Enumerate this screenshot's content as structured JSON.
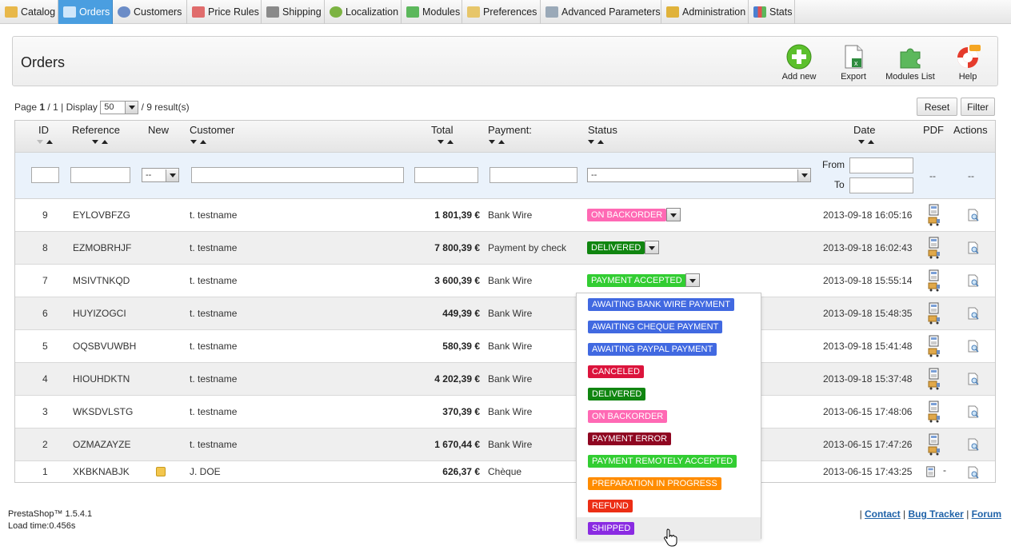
{
  "menu": {
    "tabs": [
      {
        "label": "Catalog",
        "icon": "folder-icon"
      },
      {
        "label": "Orders",
        "icon": "cart-icon"
      },
      {
        "label": "Customers",
        "icon": "user-icon"
      },
      {
        "label": "Price Rules",
        "icon": "price-tag-icon"
      },
      {
        "label": "Shipping",
        "icon": "truck-icon"
      },
      {
        "label": "Localization",
        "icon": "globe-icon"
      },
      {
        "label": "Modules",
        "icon": "puzzle-icon"
      },
      {
        "label": "Preferences",
        "icon": "preferences-icon"
      },
      {
        "label": "Advanced Parameters",
        "icon": "wrench-icon"
      },
      {
        "label": "Administration",
        "icon": "key-icon"
      },
      {
        "label": "Stats",
        "icon": "chart-icon"
      }
    ]
  },
  "toolbar": {
    "title": "Orders",
    "buttons": [
      {
        "label": "Add new",
        "icon": "add-icon"
      },
      {
        "label": "Export",
        "icon": "export-icon"
      },
      {
        "label": "Modules List",
        "icon": "modules-icon"
      },
      {
        "label": "Help",
        "icon": "help-icon"
      }
    ]
  },
  "pager": {
    "page_label": "Page",
    "page": "1",
    "sep": "/",
    "pages": "1",
    "display_label": "| Display",
    "per_page": "50",
    "results": "/ 9 result(s)"
  },
  "actions": {
    "reset": "Reset",
    "filter": "Filter"
  },
  "table": {
    "headers": {
      "id": "ID",
      "reference": "Reference",
      "new": "New",
      "customer": "Customer",
      "total": "Total",
      "payment": "Payment:",
      "status": "Status",
      "date": "Date",
      "pdf": "PDF",
      "actions": "Actions"
    },
    "filters": {
      "new_select": "--",
      "status_select": "--",
      "date_from": "From",
      "date_to": "To",
      "pdf": "--",
      "actions": "--"
    },
    "rows": [
      {
        "id": "9",
        "reference": "EYLOVBFZG",
        "customer": "t. testname",
        "total": "1 801,39 €",
        "payment": "Bank Wire",
        "status": "ON BACKORDER",
        "status_color": "#ff69b4",
        "date": "2013-09-18 16:05:16"
      },
      {
        "id": "8",
        "reference": "EZMOBRHJF",
        "customer": "t. testname",
        "total": "7 800,39 €",
        "payment": "Payment by check",
        "status": "DELIVERED",
        "status_color": "#108510",
        "date": "2013-09-18 16:02:43"
      },
      {
        "id": "7",
        "reference": "MSIVTNKQD",
        "customer": "t. testname",
        "total": "3 600,39 €",
        "payment": "Bank Wire",
        "status": "PAYMENT ACCEPTED",
        "status_color": "#32cd32",
        "date": "2013-09-18 15:55:14"
      },
      {
        "id": "6",
        "reference": "HUYIZOGCI",
        "customer": "t. testname",
        "total": "449,39 €",
        "payment": "Bank Wire",
        "status": "",
        "status_color": "",
        "date": "2013-09-18 15:48:35"
      },
      {
        "id": "5",
        "reference": "OQSBVUWBH",
        "customer": "t. testname",
        "total": "580,39 €",
        "payment": "Bank Wire",
        "status": "",
        "status_color": "",
        "date": "2013-09-18 15:41:48"
      },
      {
        "id": "4",
        "reference": "HIOUHDKTN",
        "customer": "t. testname",
        "total": "4 202,39 €",
        "payment": "Bank Wire",
        "status": "",
        "status_color": "",
        "date": "2013-09-18 15:37:48"
      },
      {
        "id": "3",
        "reference": "WKSDVLSTG",
        "customer": "t. testname",
        "total": "370,39 €",
        "payment": "Bank Wire",
        "status": "",
        "status_color": "",
        "date": "2013-06-15 17:48:06"
      },
      {
        "id": "2",
        "reference": "OZMAZAYZE",
        "customer": "t. testname",
        "total": "1 670,44 €",
        "payment": "Bank Wire",
        "status": "",
        "status_color": "",
        "date": "2013-06-15 17:47:26"
      },
      {
        "id": "1",
        "reference": "XKBKNABJK",
        "customer": "J. DOE",
        "total": "626,37 €",
        "payment": "Chèque",
        "status": "",
        "status_color": "",
        "date": "2013-06-15 17:43:25",
        "pdf_extra": "-"
      }
    ]
  },
  "status_options": [
    {
      "label": "AWAITING BANK WIRE PAYMENT",
      "color": "#4169e1"
    },
    {
      "label": "AWAITING CHEQUE PAYMENT",
      "color": "#4169e1"
    },
    {
      "label": "AWAITING PAYPAL PAYMENT",
      "color": "#4169e1"
    },
    {
      "label": "CANCELED",
      "color": "#dc143c"
    },
    {
      "label": "DELIVERED",
      "color": "#108510"
    },
    {
      "label": "ON BACKORDER",
      "color": "#ff69b4"
    },
    {
      "label": "PAYMENT ERROR",
      "color": "#8f0621"
    },
    {
      "label": "PAYMENT REMOTELY ACCEPTED",
      "color": "#32cd32"
    },
    {
      "label": "PREPARATION IN PROGRESS",
      "color": "#ff8c00"
    },
    {
      "label": "REFUND",
      "color": "#ec2e15"
    },
    {
      "label": "SHIPPED",
      "color": "#8a2be2"
    }
  ],
  "footer": {
    "version": "PrestaShop™ 1.5.4.1",
    "load_time": "Load time:0.456s",
    "links": [
      "Contact",
      "Bug Tracker",
      "Forum"
    ]
  }
}
